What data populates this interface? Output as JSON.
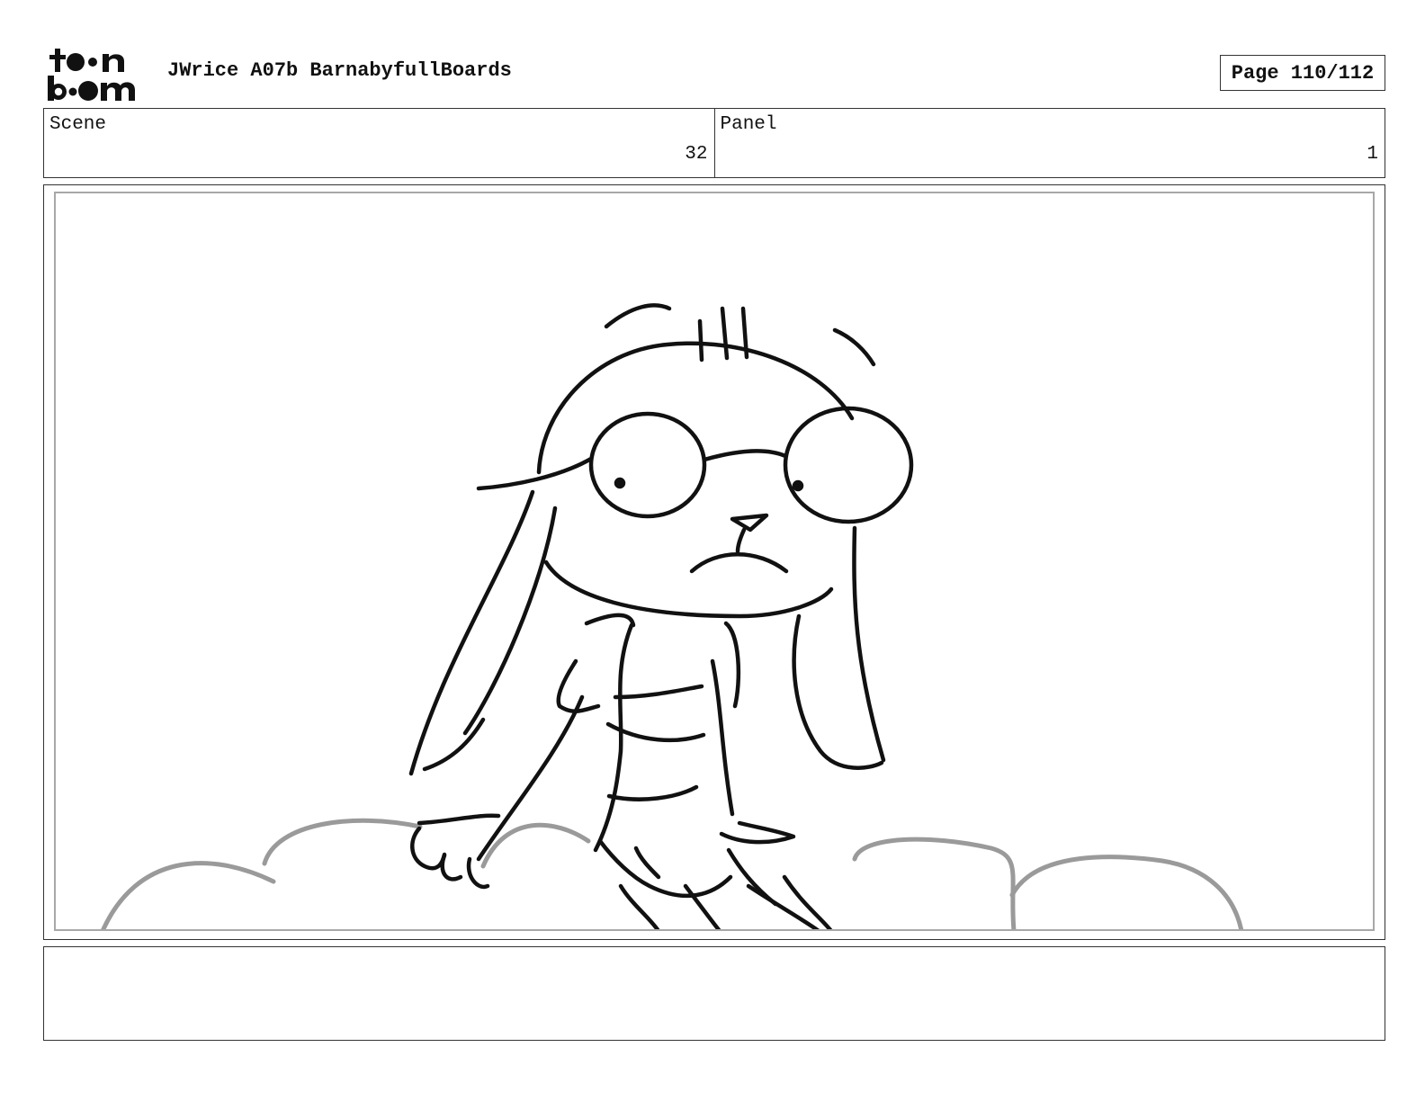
{
  "header": {
    "logo_text": "toon boom",
    "project_title": "JWrice A07b BarnabyfullBoards",
    "page_label": "Page 110/112"
  },
  "info": {
    "scene_label": "Scene",
    "scene_value": "32",
    "panel_label": "Panel",
    "panel_value": "1"
  },
  "panel": {
    "drawing": "sketch-rabbit-character-on-clouds",
    "line_color": "#111111",
    "cloud_color": "#9a9a9a"
  },
  "caption": {
    "text": ""
  }
}
